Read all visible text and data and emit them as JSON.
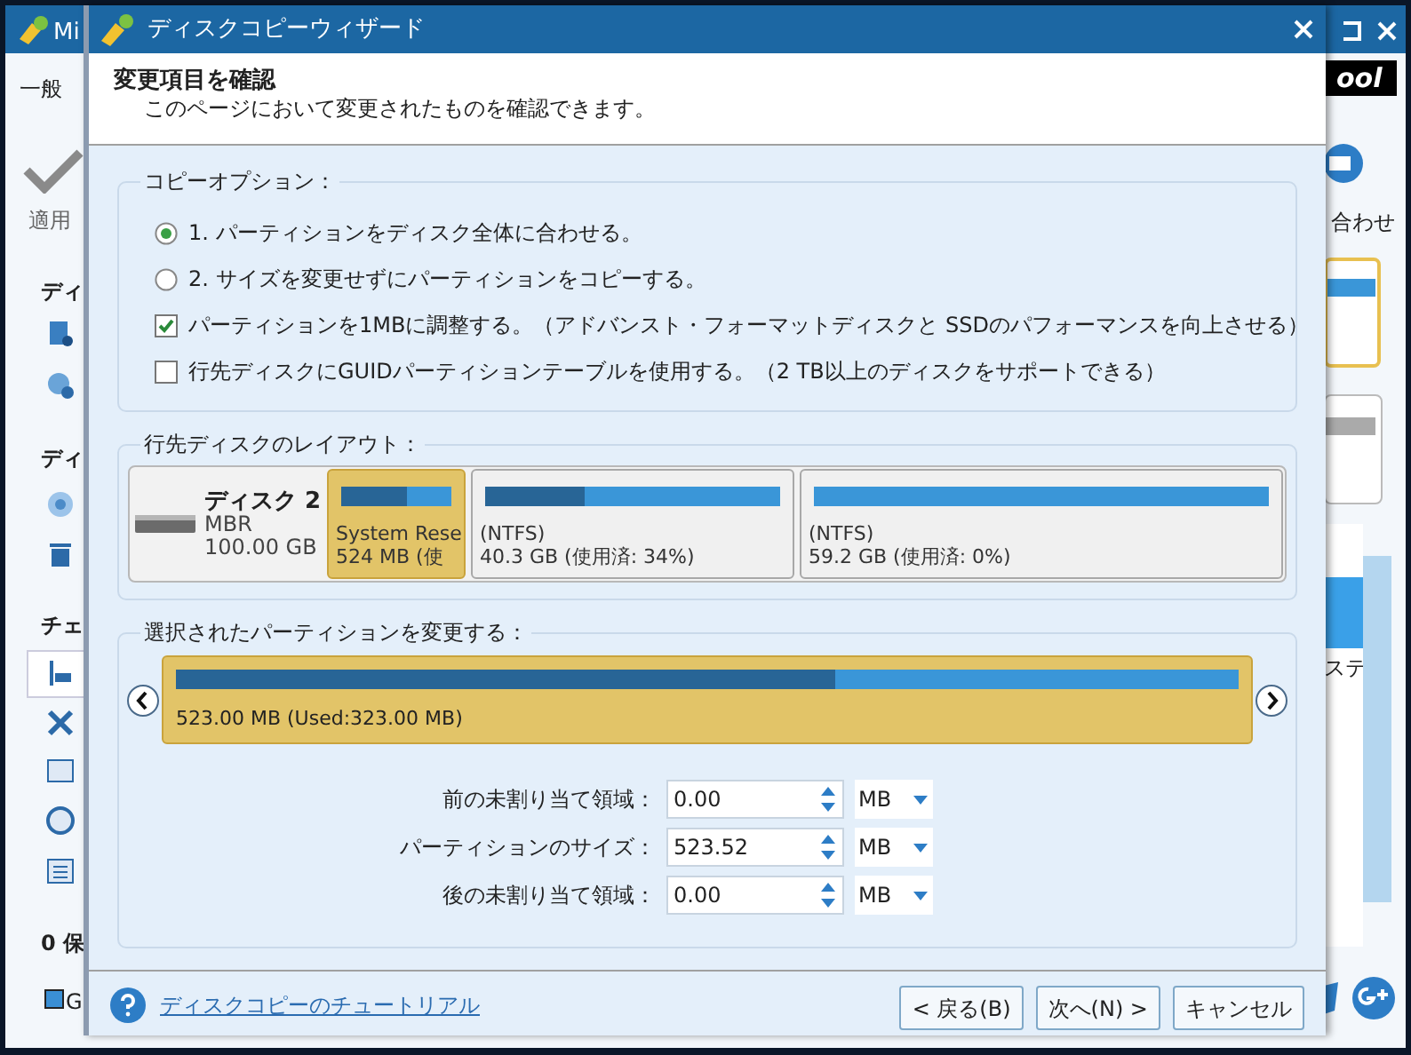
{
  "app": {
    "title": "Mi",
    "tab": "一般",
    "apply": "適用",
    "section_1": "ディ",
    "section_2": "ディ",
    "section_3": "チェ",
    "pending": "0 保",
    "legend": "G",
    "logo": "ool",
    "contact": "合わせ",
    "list_item": "ステ"
  },
  "dialog": {
    "title": "ディスクコピーウィザード",
    "heading": "変更項目を確認",
    "subheading": "このページにおいて変更されたものを確認できます。",
    "copy_options": {
      "legend": "コピーオプション：",
      "items": [
        {
          "kind": "radio",
          "label": "1. パーティションをディスク全体に合わせる。",
          "selected": true
        },
        {
          "kind": "radio",
          "label": "2. サイズを変更せずにパーティションをコピーする。",
          "selected": false
        },
        {
          "kind": "checkbox",
          "label": "パーティションを1MBに調整する。（アドバンスト・フォーマットディスクと SSDのパフォーマンスを向上させる）",
          "checked": true
        },
        {
          "kind": "checkbox",
          "label": "行先ディスクにGUIDパーティションテーブルを使用する。（2 TB以上のディスクをサポートできる）",
          "checked": false
        }
      ]
    },
    "layout": {
      "legend": "行先ディスクのレイアウト：",
      "disk": {
        "name": "ディスク 2",
        "type": "MBR",
        "size": "100.00 GB"
      },
      "partitions": [
        {
          "line_1": "System Rese",
          "line_2": "524 MB (使",
          "level": 0.6,
          "selected": true
        },
        {
          "line_1": "(NTFS)",
          "line_2": "40.3 GB (使用済: 34%)",
          "level": 0.34,
          "selected": false
        },
        {
          "line_1": "(NTFS)",
          "line_2": "59.2 GB (使用済: 0%)",
          "level": 0,
          "selected": false
        }
      ]
    },
    "resize": {
      "legend": "選択されたパーティションを変更する：",
      "partition_label": "523.00 MB (Used:323.00 MB)",
      "level": 0.62,
      "fields": [
        {
          "label": "前の未割り当て領域：",
          "value": "0.00",
          "unit": "MB"
        },
        {
          "label": "パーティションのサイズ：",
          "value": "523.52",
          "unit": "MB"
        },
        {
          "label": "後の未割り当て領域：",
          "value": "0.00",
          "unit": "MB"
        }
      ]
    },
    "tutorial_link": "ディスクコピーのチュートリアル",
    "buttons": [
      "< 戻る(B)",
      "次へ(N) >",
      "キャンセル"
    ]
  }
}
